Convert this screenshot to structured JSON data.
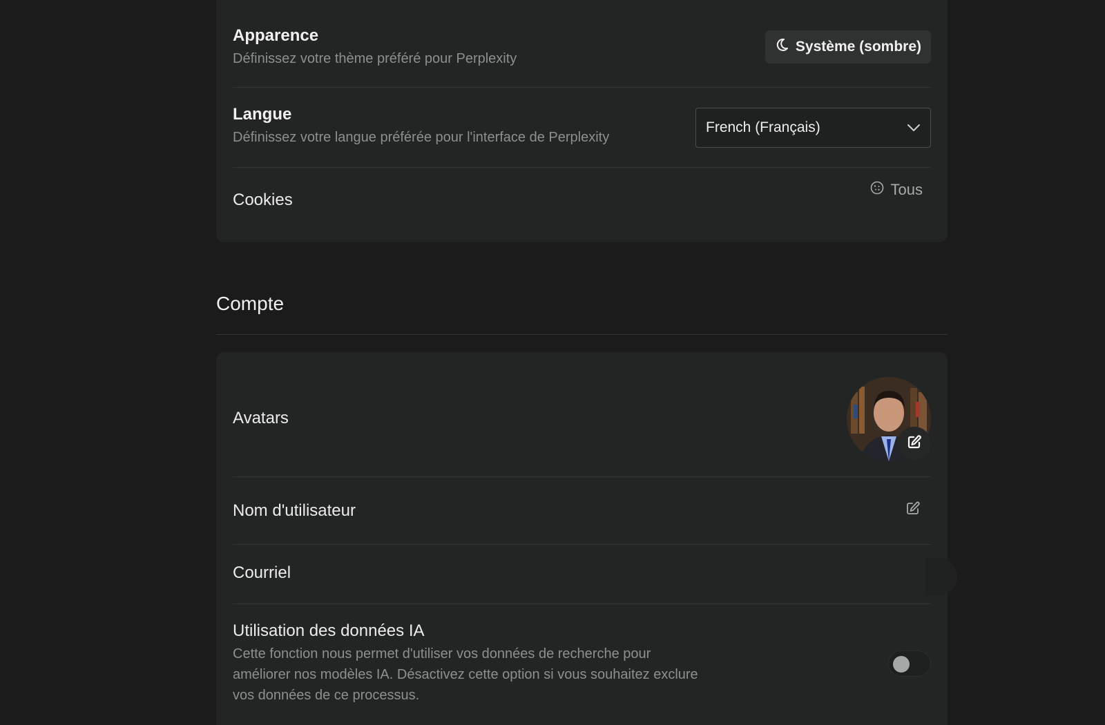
{
  "preferences": {
    "appearance": {
      "title": "Apparence",
      "description": "Définissez votre thème préféré pour Perplexity",
      "value": "Système (sombre)",
      "icon": "moon-icon"
    },
    "language": {
      "title": "Langue",
      "description": "Définissez votre langue préférée pour l'interface de Perplexity",
      "value": "French (Français)",
      "icon": "chevron-down-icon"
    },
    "cookies": {
      "label": "Cookies",
      "value": "Tous",
      "icon": "cookie-icon"
    }
  },
  "account": {
    "heading": "Compte",
    "avatar": {
      "label": "Avatars",
      "edit_icon": "edit-icon"
    },
    "username": {
      "label": "Nom d'utilisateur",
      "edit_icon": "edit-icon"
    },
    "email": {
      "label": "Courriel"
    },
    "ai_data": {
      "title": "Utilisation des données IA",
      "description_line1": "Cette fonction nous permet d'utiliser vos données de recherche pour",
      "description_line2": "améliorer nos modèles IA. Désactivez cette option si vous souhaitez exclure",
      "description_line3": "vos données de ce processus.",
      "enabled": false
    }
  },
  "colors": {
    "background": "#1b1b1b",
    "card": "#232424",
    "text_primary": "#f1f1f1",
    "text_secondary": "#8e8f8f",
    "divider": "#343535"
  }
}
